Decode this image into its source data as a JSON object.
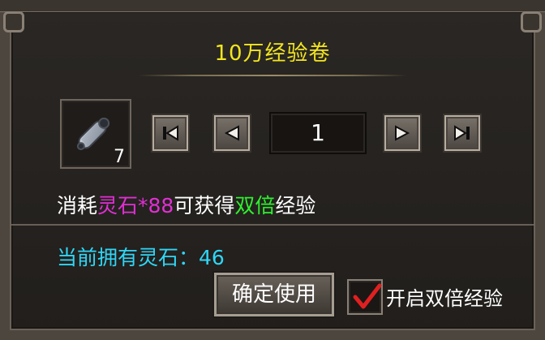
{
  "dialog": {
    "title": "10万经验卷",
    "quantity": "1",
    "item_count": "7",
    "cost_prefix": "消耗",
    "cost_item": "灵石*88",
    "cost_middle": "可获得",
    "cost_highlight": "双倍",
    "cost_suffix": "经验",
    "owned_label": "当前拥有灵石：",
    "owned_value": "46",
    "confirm_label": "确定使用",
    "double_exp_label": "开启双倍经验",
    "double_exp_checked": true
  },
  "colors": {
    "title": "#f2e51f",
    "magenta": "#e02fd3",
    "green": "#2ef02e",
    "cyan": "#2fd6f6",
    "check_red": "#e02020"
  },
  "icons": {
    "item": "scroll-icon",
    "first": "skip-first-icon",
    "prev": "triangle-left-icon",
    "next": "triangle-right-icon",
    "last": "skip-last-icon",
    "check": "checkmark-icon"
  }
}
